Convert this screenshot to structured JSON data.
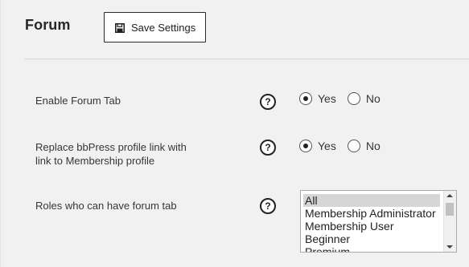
{
  "header": {
    "title": "Forum",
    "save_label": "Save Settings"
  },
  "settings": {
    "enable_forum_tab": {
      "label": "Enable Forum Tab",
      "help": "?",
      "options": [
        {
          "label": "Yes",
          "checked": true
        },
        {
          "label": "No",
          "checked": false
        }
      ]
    },
    "replace_profile_link": {
      "label_line1": "Replace bbPress profile link with",
      "label_line2": "link to Membership profile",
      "help": "?",
      "options": [
        {
          "label": "Yes",
          "checked": true
        },
        {
          "label": "No",
          "checked": false
        }
      ]
    },
    "roles": {
      "label": "Roles who can have forum tab",
      "help": "?",
      "options": [
        "All",
        "Membership Administrator",
        "Membership User",
        "Beginner",
        "Premium"
      ],
      "selected": "All"
    }
  },
  "colors": {
    "background": "#f1f1f1",
    "text": "#32373c",
    "selected_option": "#d6d6d6"
  },
  "icons": {
    "save": "floppy-disk-icon",
    "help": "question-circle-icon"
  }
}
